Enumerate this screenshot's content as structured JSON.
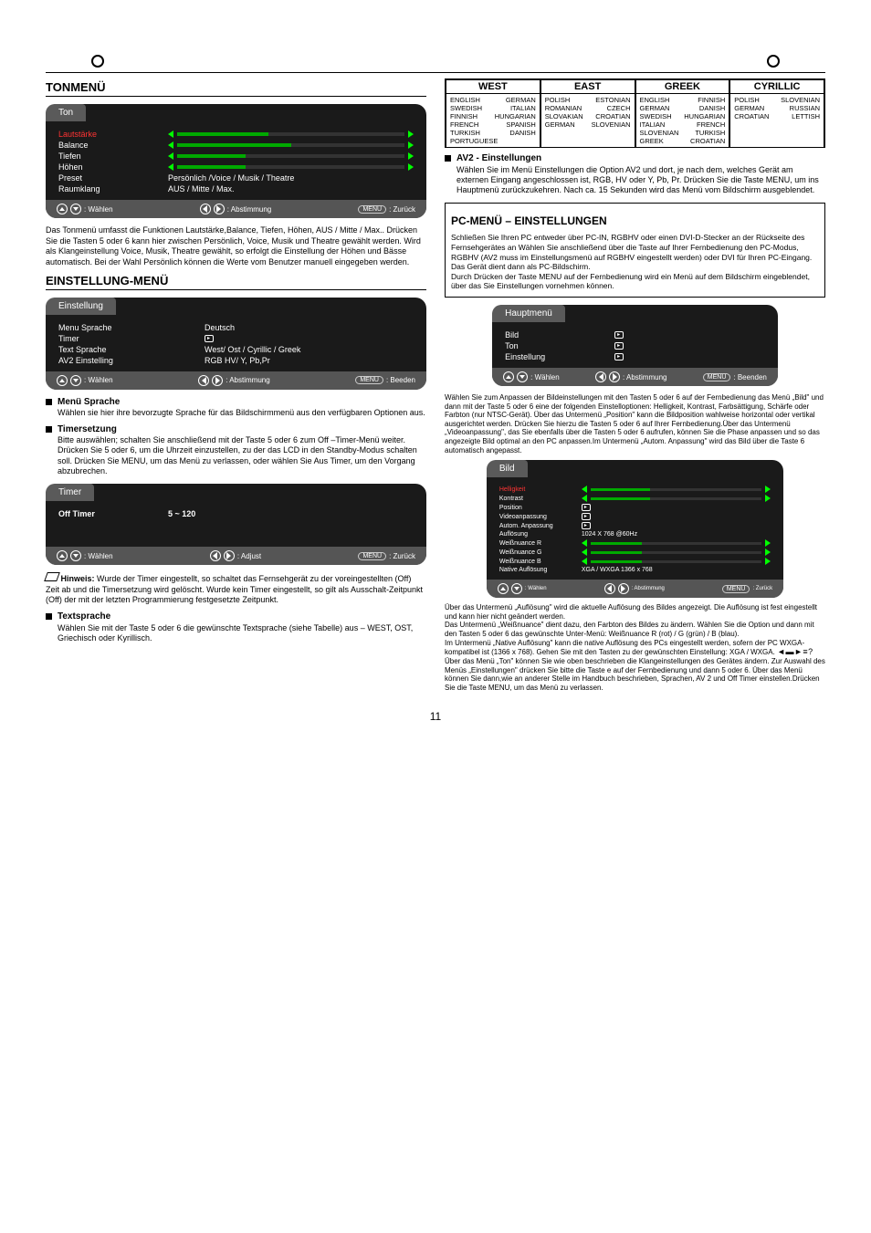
{
  "header_rule": true,
  "left": {
    "ton_menu": {
      "title": "TONMENÜ",
      "osd_title": "Ton",
      "items": [
        {
          "label": "Lautstärke",
          "type": "slider",
          "highlight": true
        },
        {
          "label": "Balance",
          "type": "slider"
        },
        {
          "label": "Tiefen",
          "type": "slider"
        },
        {
          "label": "Höhen",
          "type": "slider"
        },
        {
          "label": "Preset",
          "value": "Persönlich /Voice / Musik / Theatre"
        },
        {
          "label": "Raumklang",
          "value": "AUS / Mitte / Max."
        }
      ],
      "foot": {
        "select": ": Wählen",
        "adjust": ": Abstimmung",
        "back": ": Zurück",
        "menu_label": "MENU"
      },
      "body": "Das Tonmenü umfasst die Funktionen Lautstärke,Balance, Tiefen, Höhen, AUS / Mitte / Max.. Drücken Sie die Tasten 5 oder 6 kann hier zwischen Persönlich, Voice, Musik und Theatre gewählt werden. Wird als Klangeinstellung Voice, Musik, Theatre gewählt, so erfolgt die Einstellung der Höhen und Bässe automatisch. Bei der Wahl Persönlich können die Werte vom Benutzer manuell eingegeben werden."
    },
    "einstellung": {
      "title": "EINSTELLUNG-MENÜ",
      "osd_title": "Einstellung",
      "rows": [
        {
          "label": "Menu Sprache",
          "value": "Deutsch"
        },
        {
          "label": "Timer",
          "value": "▶"
        },
        {
          "label": "Text Sprache",
          "value": "West/ Ost / Cyrillic / Greek"
        },
        {
          "label": "AV2  Einstelling",
          "value": "RGB HV/ Y, Pb,Pr"
        }
      ],
      "foot": {
        "select": ": Wählen",
        "adjust": ": Abstimmung",
        "exit": ": Beeden",
        "menu_label": "MENU"
      },
      "sprache": {
        "heading": "Menü Sprache",
        "body": "Wählen sie hier ihre bevorzugte Sprache für das Bildschirmmenü aus den verfügbaren Optionen aus."
      },
      "timersetzung": {
        "heading": "Timersetzung",
        "body1": "Bitte auswählen; schalten Sie anschließend mit der Taste 5 oder 6 zum Off –Timer-Menü weiter. Drücken Sie 5 oder 6, um die Uhrzeit einzustellen, zu der das LCD in den Standby-Modus schalten soll. Drücken Sie MENU, um das Menü zu verlassen, oder wählen Sie Aus Timer, um den Vorgang abzubrechen.",
        "osd_title": "Timer",
        "row_label": "Off Timer",
        "row_value": "5 ~ 120",
        "foot": {
          "select": ": Wählen",
          "adjust": ": Adjust",
          "back": ": Zurück",
          "menu_label": "MENU"
        },
        "note_intro": "Hinweis:",
        "note_body": "Wurde der Timer eingestellt, so schaltet das Fernsehgerät zu der voreingestellten (Off) Zeit ab und die Timersetzung wird gelöscht. Wurde kein Timer eingestellt, so gilt als Ausschalt-Zeitpunkt (Off) der mit der letzten Programmierung festgesetzte Zeitpunkt."
      },
      "textsprache": {
        "heading": "Textsprache",
        "body": "Wählen Sie mit der Taste 5 oder 6 die gewünschte Textsprache (siehe Tabelle) aus – WEST, OST, Griechisch oder Kyrillisch."
      }
    }
  },
  "right": {
    "lang_table": {
      "headers": [
        "WEST",
        "EAST",
        "GREEK",
        "CYRILLIC"
      ],
      "cols": [
        [
          [
            "ENGLISH",
            "GERMAN"
          ],
          [
            "SWEDISH",
            "ITALIAN"
          ],
          [
            "FINNISH",
            "HUNGARIAN"
          ],
          [
            "FRENCH",
            "SPANISH"
          ],
          [
            "TURKISH",
            "DANISH"
          ],
          [
            "PORTUGUESE",
            ""
          ]
        ],
        [
          [
            "POLISH",
            "ESTONIAN"
          ],
          [
            "ROMANIAN",
            "CZECH"
          ],
          [
            "SLOVAKIAN",
            "CROATIAN"
          ],
          [
            "GERMAN",
            "SLOVENIAN"
          ]
        ],
        [
          [
            "ENGLISH",
            "FINNISH"
          ],
          [
            "GERMAN",
            "DANISH"
          ],
          [
            "SWEDISH",
            "HUNGARIAN"
          ],
          [
            "ITALIAN",
            "FRENCH"
          ],
          [
            "SLOVENIAN",
            "TURKISH"
          ],
          [
            "GREEK",
            "CROATIAN"
          ]
        ],
        [
          [
            "POLISH",
            "SLOVENIAN"
          ],
          [
            "GERMAN",
            "RUSSIAN"
          ],
          [
            "CROATIAN",
            "LETTISH"
          ]
        ]
      ]
    },
    "av2": {
      "heading": "AV2 - Einstellungen",
      "body": "Wählen Sie im Menü Einstellungen die Option  AV2 und dort, je nach dem, welches Gerät am externen Eingang  angeschlossen ist, RGB, HV oder Y, Pb, Pr. Drücken Sie die Taste MENU, um ins Hauptmenü zurückzukehren. Nach ca. 15 Sekunden wird das Menü vom Bildschirm ausgeblendet."
    },
    "pcbox": {
      "title": "PC-MENÜ – EINSTELLUNGEN",
      "p1": "Schließen Sie Ihren PC entweder über PC-IN, RGBHV oder einen DVI-D-Stecker an der Rückseite des Fernsehgerätes an Wählen Sie anschließend über die Taste          auf Ihrer Fernbedienung den PC-Modus, RGBHV (AV2 muss im Einstellungsmenü auf RGBHV eingestellt werden) oder DVI für Ihren PC-Eingang. Das Gerät dient dann als PC-Bildschirm.",
      "p2": "Durch Drücken der Taste MENU auf der Fernbedienung wird ein Menü auf dem Bildschirm eingeblendet, über das Sie Einstellungen vornehmen können.",
      "pc_symbol_note": "⬚ ⬚"
    },
    "hauptmenu": {
      "osd_title": "Hauptmenü",
      "rows": [
        {
          "label": "Bild"
        },
        {
          "label": "Ton"
        },
        {
          "label": "Einstellung"
        }
      ],
      "foot": {
        "select": ": Wählen",
        "adjust": ": Abstimmung",
        "exit": ": Beenden",
        "menu_label": "MENU"
      },
      "body": "Wählen Sie zum Anpassen der Bildeinstellungen mit den Tasten 5 oder 6 auf der Fernbedienung das Menü „Bild\" und dann mit der Taste 5 oder 6 eine der folgenden Einstelloptionen: Helligkeit, Kontrast, Farbsättigung, Schärfe oder Farbton (nur NTSC-Gerät). Über das Untermenü „Position\" kann die Bildposition wahlweise horizontal oder vertikal ausgerichtet werden. Drücken Sie hierzu die Tasten 5 oder 6 auf Ihrer Fernbedienung.Über das Untermenü „Videoanpassung\", das Sie ebenfalls über die Tasten 5 oder 6 aufrufen, können Sie die Phase anpassen und so das angezeigte Bild optimal an den PC anpassen.Im Untermenü „Autom. Anpassung\" wird das Bild über die Taste 6 automatisch angepasst."
    },
    "bild": {
      "osd_title": "Bild",
      "rows": [
        {
          "label": "Helligkeit",
          "type": "slider",
          "highlight": true
        },
        {
          "label": "Kontrast",
          "type": "slider"
        },
        {
          "label": "Position",
          "type": "sub"
        },
        {
          "label": "Videoanpassung",
          "type": "sub"
        },
        {
          "label": "Autom. Anpassung",
          "type": "sub"
        },
        {
          "label": "Auflösung",
          "value": "1024 X  768         @60Hz"
        },
        {
          "label": "Weißnuance R",
          "type": "slider"
        },
        {
          "label": "Weißnuance G",
          "type": "slider"
        },
        {
          "label": "Weißnuance B",
          "type": "slider"
        },
        {
          "label": "Native Auflösung",
          "value": "XGA / WXGA 1366 x 768"
        }
      ],
      "foot": {
        "select": ": Wählen",
        "adjust": ": Abstimmung",
        "back": ": Zurück",
        "menu_label": "MENU"
      },
      "body1": "Über das Untermenü „Auflösung\" wird die aktuelle Auflösung des Bildes angezeigt. Die Auflösung ist fest eingestellt und kann hier nicht geändert werden.",
      "body2": "Das Untermenü „Weißnuance\" dient dazu, den Farbton des Bildes zu ändern. Wählen Sie die Option und dann mit den Tasten 5 oder 6 das gewünschte Unter-Menü: Weißnuance R (rot) / G (grün) / B (blau).",
      "body3": "Im Untermenü „Native Auflösung\" kann die native Auflösung des PCs eingestellt werden, sofern der PC WXGA-kompatibel ist (1366 x 768).  Gehen Sie mit den Tasten           zu der gewünschten Einstellung: XGA / WXGA.",
      "body4": "Über das Menü „Ton\" können Sie wie oben beschrieben die Klangeinstellungen des Gerätes ändern. Zur Auswahl des Menüs „Einstellungen\" drücken Sie bitte die Taste e auf der Fernbedienung und dann 5 oder 6. Über das Menü können Sie dann,wie an anderer Stelle im Handbuch beschrieben, Sprachen, AV 2 und Off Timer einstellen.Drücken Sie die Taste MENU, um das Menü zu verlassen.",
      "nav_icons": "◄ ▬ ► ≡ ?"
    }
  },
  "page_number": "11"
}
